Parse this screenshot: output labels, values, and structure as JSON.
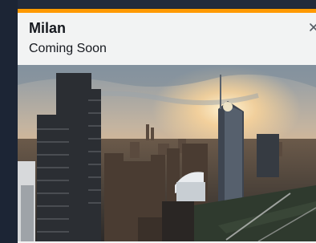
{
  "popup": {
    "city": "Milan",
    "status": "Coming Soon",
    "close_icon": "close-icon",
    "accent_color": "#ff9900",
    "image": {
      "subject": "milan-skyline-photo"
    }
  }
}
